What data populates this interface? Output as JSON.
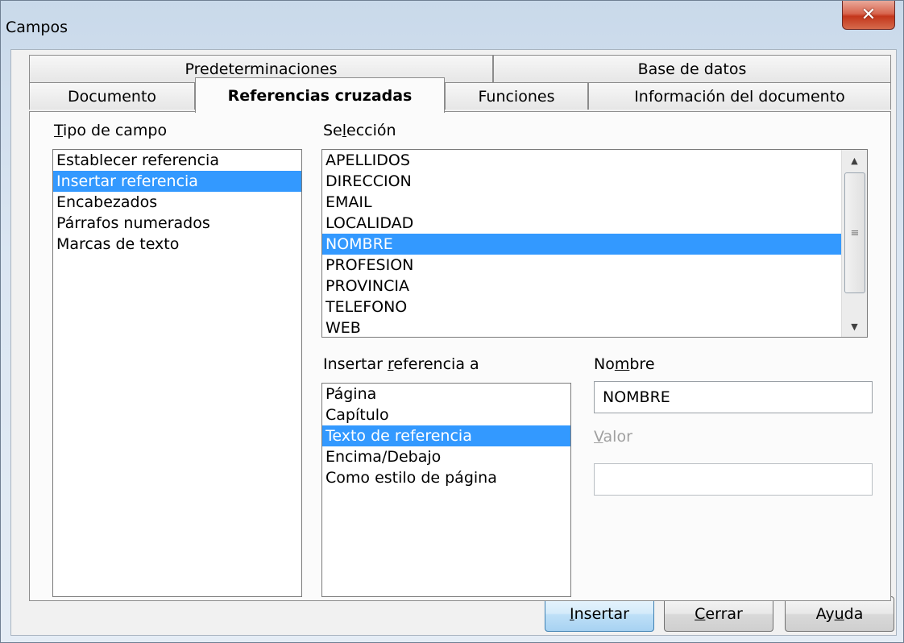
{
  "window": {
    "title": "Campos",
    "close_glyph": "✕"
  },
  "tabs": {
    "row1": [
      "Predeterminaciones",
      "Base de datos"
    ],
    "row2": [
      "Documento",
      "Referencias cruzadas",
      "Funciones",
      "Información del documento"
    ],
    "active": "Referencias cruzadas"
  },
  "tipo_de_campo": {
    "label": "Tipo de campo",
    "items": [
      "Establecer referencia",
      "Insertar referencia",
      "Encabezados",
      "Párrafos numerados",
      "Marcas de texto"
    ],
    "selected": "Insertar referencia"
  },
  "seleccion": {
    "label": "Selección",
    "items": [
      "APELLIDOS",
      "DIRECCION",
      "EMAIL",
      "LOCALIDAD",
      "NOMBRE",
      "PROFESION",
      "PROVINCIA",
      "TELEFONO",
      "WEB"
    ],
    "selected": "NOMBRE"
  },
  "insertar_referencia_a": {
    "label": "Insertar referencia a",
    "items": [
      "Página",
      "Capítulo",
      "Texto de referencia",
      "Encima/Debajo",
      "Como estilo de página"
    ],
    "selected": "Texto de referencia"
  },
  "nombre": {
    "label": "Nombre",
    "value": "NOMBRE"
  },
  "valor": {
    "label": "Valor",
    "value": ""
  },
  "buttons": {
    "insertar": "Insertar",
    "cerrar": "Cerrar",
    "ayuda": "Ayuda"
  },
  "colors": {
    "selection": "#3399ff",
    "panel": "#fbfbfb"
  },
  "icons": {
    "scroll_up": "scroll-up-arrow-icon",
    "scroll_down": "scroll-down-arrow-icon",
    "thumb_grip": "grip-icon"
  }
}
